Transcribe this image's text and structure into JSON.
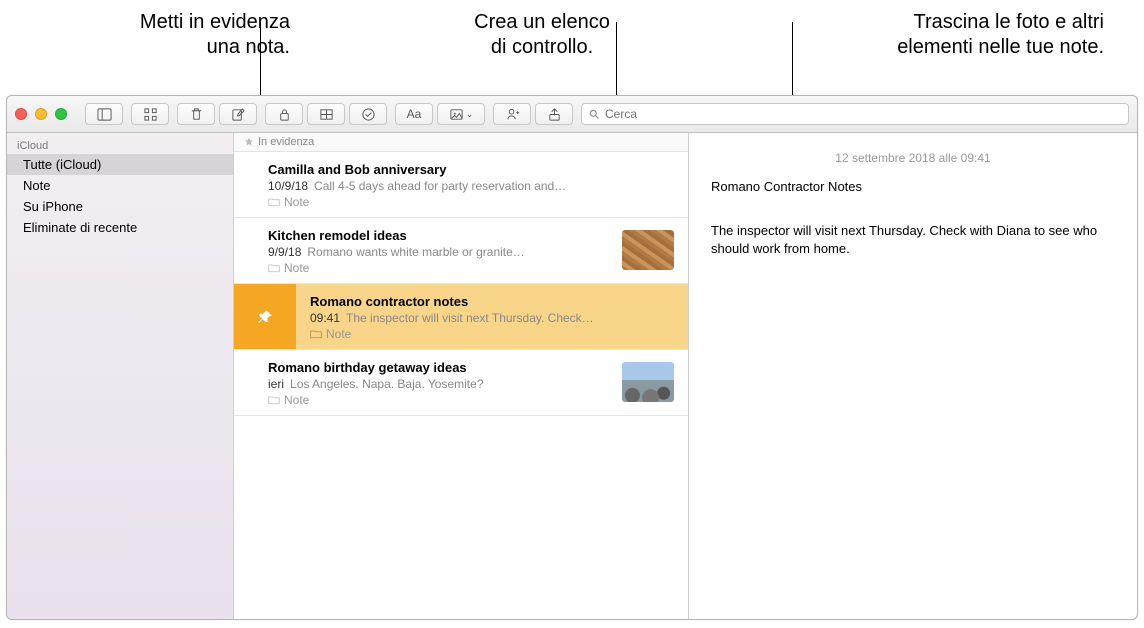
{
  "callouts": {
    "left_l1": "Metti in evidenza",
    "left_l2": "una nota.",
    "mid_l1": "Crea un elenco",
    "mid_l2": "di controllo.",
    "right_l1": "Trascina le foto e altri",
    "right_l2": "elementi nelle tue note."
  },
  "search": {
    "placeholder": "Cerca"
  },
  "sidebar": {
    "group": "iCloud",
    "items": [
      "Tutte (iCloud)",
      "Note",
      "Su iPhone",
      "Eliminate di recente"
    ]
  },
  "list": {
    "section_header": "In evidenza",
    "notes": [
      {
        "title": "Camilla and Bob anniversary",
        "date": "10/9/18",
        "preview": "Call 4-5 days ahead for party reservation and…",
        "folder": "Note",
        "has_thumb": false
      },
      {
        "title": "Kitchen remodel ideas",
        "date": "9/9/18",
        "preview": "Romano wants white marble or granite…",
        "folder": "Note",
        "has_thumb": true,
        "thumb": "wood"
      },
      {
        "title": "Romano contractor notes",
        "date": "09:41",
        "preview": "The inspector will visit next Thursday. Check…",
        "folder": "Note",
        "pinned_selected": true
      },
      {
        "title": "Romano birthday getaway ideas",
        "date": "ieri",
        "preview": "Los Angeles. Napa. Baja. Yosemite?",
        "folder": "Note",
        "has_thumb": true,
        "thumb": "rocks"
      }
    ]
  },
  "detail": {
    "timestamp": "12 settembre 2018 alle 09:41",
    "title": "Romano Contractor Notes",
    "body": "The inspector will visit next Thursday. Check with Diana to see who should work from home."
  }
}
